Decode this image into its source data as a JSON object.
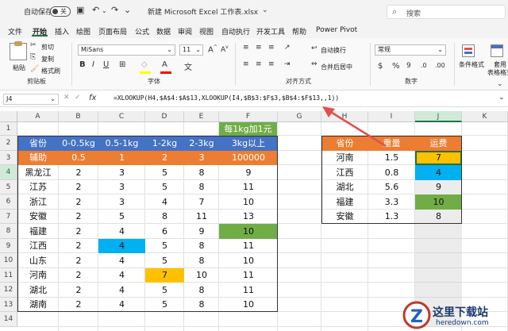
{
  "titlebar": {
    "autosave_label": "自动保存",
    "autosave_state": "关",
    "filename": "新建 Microsoft Excel 工作表.xlsx",
    "search_placeholder": "搜索"
  },
  "menu": [
    "文件",
    "开始",
    "插入",
    "绘图",
    "页面布局",
    "公式",
    "数据",
    "审阅",
    "视图",
    "自动执行",
    "开发工具",
    "帮助",
    "Power Pivot"
  ],
  "ribbon": {
    "paste": "粘贴",
    "cut": "剪切",
    "copy": "复制",
    "format_painter": "格式刷",
    "clipboard_group": "剪贴板",
    "font_name": "MiSans",
    "font_size": "11",
    "font_group": "字体",
    "wrap_text": "自动换行",
    "merge_center": "合并后居中",
    "align_group": "对齐方式",
    "number_format": "常规",
    "number_group": "数字",
    "conditional_format": "条件格式",
    "table_format_1": "套用",
    "table_format_2": "表格格式"
  },
  "formula_bar": {
    "name_box": "J4",
    "fx": "fx",
    "formula": "=XLOOKUP(H4,$A$4:$A$13,XLOOKUP(I4,$B$3:$F$3,$B$4:$F$13,,1))"
  },
  "columns": [
    "A",
    "B",
    "C",
    "D",
    "E",
    "F",
    "G",
    "H",
    "I",
    "J",
    "K"
  ],
  "rows": [
    "1",
    "2",
    "3",
    "4",
    "5",
    "6",
    "7",
    "8",
    "9",
    "10",
    "11",
    "12",
    "13",
    "14"
  ],
  "note_f1": "每1kg加1元",
  "main_table": {
    "header": [
      "省份",
      "0-0.5kg",
      "0.5-1kg",
      "1-2kg",
      "2-3kg",
      "3kg以上"
    ],
    "aux": [
      "辅助",
      "0.5",
      "1",
      "2",
      "3",
      "100000"
    ],
    "rows": [
      [
        "黑龙江",
        "2",
        "3",
        "5",
        "8",
        "9"
      ],
      [
        "江苏",
        "2",
        "3",
        "5",
        "8",
        "11"
      ],
      [
        "浙江",
        "2",
        "3",
        "4",
        "7",
        "10"
      ],
      [
        "安徽",
        "2",
        "5",
        "8",
        "11",
        "13"
      ],
      [
        "福建",
        "2",
        "4",
        "6",
        "9",
        "10"
      ],
      [
        "江西",
        "2",
        "4",
        "5",
        "8",
        "11"
      ],
      [
        "山东",
        "2",
        "4",
        "5",
        "8",
        "10"
      ],
      [
        "河南",
        "2",
        "4",
        "7",
        "10",
        "11"
      ],
      [
        "湖北",
        "2",
        "4",
        "5",
        "8",
        "11"
      ],
      [
        "湖南",
        "2",
        "4",
        "5",
        "8",
        "10"
      ]
    ]
  },
  "lookup_table": {
    "header": [
      "省份",
      "重量",
      "运费"
    ],
    "rows": [
      [
        "河南",
        "1.5",
        "7"
      ],
      [
        "江西",
        "0.8",
        "4"
      ],
      [
        "湖北",
        "5.6",
        "9"
      ],
      [
        "福建",
        "3.3",
        "10"
      ],
      [
        "安徽",
        "1.3",
        "8"
      ]
    ]
  },
  "colors": {
    "header_blue": "#4472c4",
    "aux_orange": "#ed7d31",
    "highlight_orange": "#ffc000",
    "highlight_blue": "#00b0f0",
    "highlight_green": "#70ad47",
    "arrow_red": "#e05050",
    "excel_green": "#1e7145"
  },
  "watermark": {
    "title": "这里下载站",
    "url": "heredown.com"
  }
}
